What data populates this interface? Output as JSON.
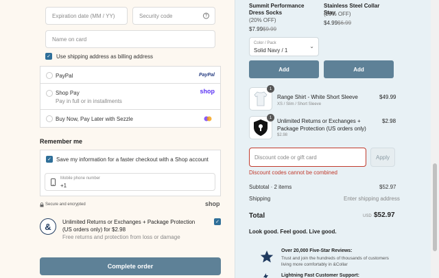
{
  "payment": {
    "expiration_placeholder": "Expiration date (MM / YY)",
    "security_placeholder": "Security code",
    "name_placeholder": "Name on card",
    "billing_same_label": "Use shipping address as billing address",
    "options": [
      {
        "label": "PayPal",
        "logo": "PayPal"
      },
      {
        "label": "Shop Pay",
        "sublabel": "Pay in full or in installments",
        "logo": "shop"
      },
      {
        "label": "Buy Now, Pay Later with Sezzle"
      }
    ]
  },
  "remember": {
    "heading": "Remember me",
    "save_label": "Save my information for a faster checkout with a Shop account",
    "phone_label": "Mobile phone number",
    "phone_value": "+1",
    "secure_label": "Secure and encrypted",
    "shop_logo": "shop"
  },
  "protection": {
    "title": "Unlimited Returns or Exchanges + Package Protection (US orders only) for $2.98",
    "subtitle": "Free returns and protection from loss or damage",
    "icon_glyph": "&"
  },
  "complete_order_label": "Complete order",
  "upsell": {
    "items": [
      {
        "title": "Summit Performance Dress Socks",
        "discount": "(20% OFF)",
        "price": "$7.99",
        "old_price": "$9.99"
      },
      {
        "title": "Stainless Steel Collar Stay",
        "discount": "(29% OFF)",
        "price": "$4.99",
        "old_price": "$6.99"
      }
    ],
    "variant_label": "Color / Pack",
    "variant_value": "Solid Navy / 1",
    "add_label": "Add"
  },
  "cart": {
    "items": [
      {
        "qty": "1",
        "title": "Range Shirt - White Short Sleeve",
        "variant": "XS / Slim / Short Sleeve",
        "price": "$49.99"
      },
      {
        "qty": "1",
        "title": "Unlimited Returns or Exchanges + Package Protection (US orders only)",
        "variant": "$2.98",
        "price": "$2.98"
      }
    ]
  },
  "discount": {
    "placeholder": "Discount code or gift card",
    "apply_label": "Apply",
    "error": "Discount codes cannot be combined"
  },
  "summary": {
    "subtotal_label": "Subtotal · 2 items",
    "subtotal_value": "$52.97",
    "shipping_label": "Shipping",
    "shipping_value": "Enter shipping address",
    "total_label": "Total",
    "currency": "USD",
    "total_value": "$52.97"
  },
  "tagline": "Look good. Feel good. Live good.",
  "reviews": {
    "title": "Over 20,000 Five-Star Reviews:",
    "body": "Trust and join the hundreds of thousands of customers living more comfortably in &Collar"
  },
  "shipping_support": {
    "title": "Lightning Fast Customer Support:"
  },
  "colors": {
    "accent": "#5e8197",
    "checkbox": "#2f6f99",
    "error": "#c0392b",
    "right_bg": "#e8f1f5",
    "left_bg": "#fdf8f1"
  }
}
